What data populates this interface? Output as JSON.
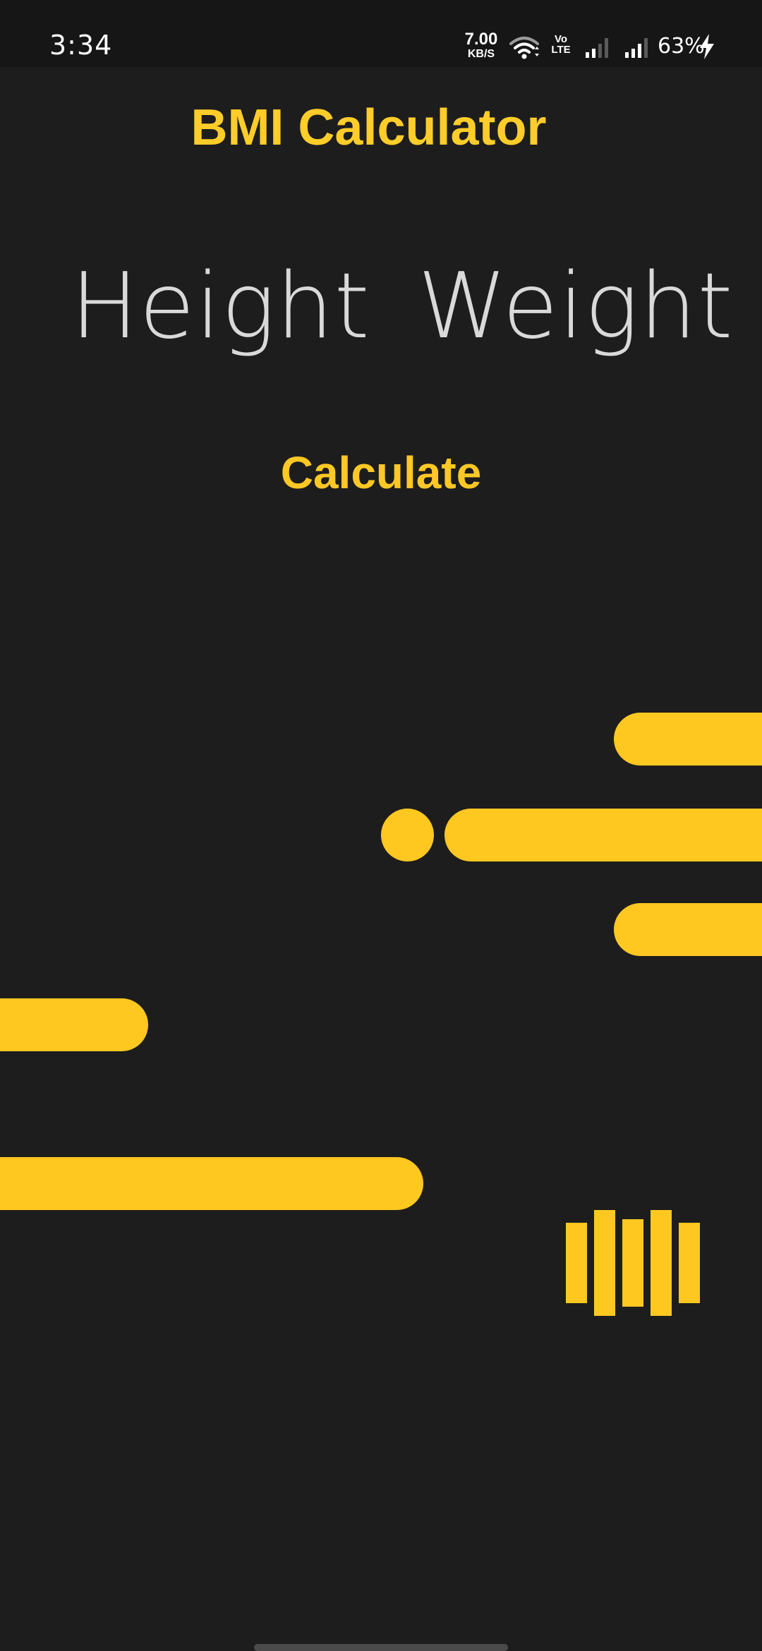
{
  "status_bar": {
    "time": "3:34",
    "net_speed_value": "7.00",
    "net_speed_unit": "KB/S",
    "volte_line1": "Vo",
    "volte_line2": "LTE",
    "battery": "63%",
    "icons": [
      "wifi-icon",
      "volte-icon",
      "signal-icon",
      "signal-icon",
      "charging-bolt-icon"
    ]
  },
  "app": {
    "title": "BMI Calculator",
    "height_label": "Height",
    "weight_label": "Weight",
    "calculate_label": "Calculate"
  },
  "colors": {
    "background": "#1d1d1d",
    "accent": "#ffc820",
    "title": "#ffcd29",
    "label": "#d9d9d9"
  }
}
